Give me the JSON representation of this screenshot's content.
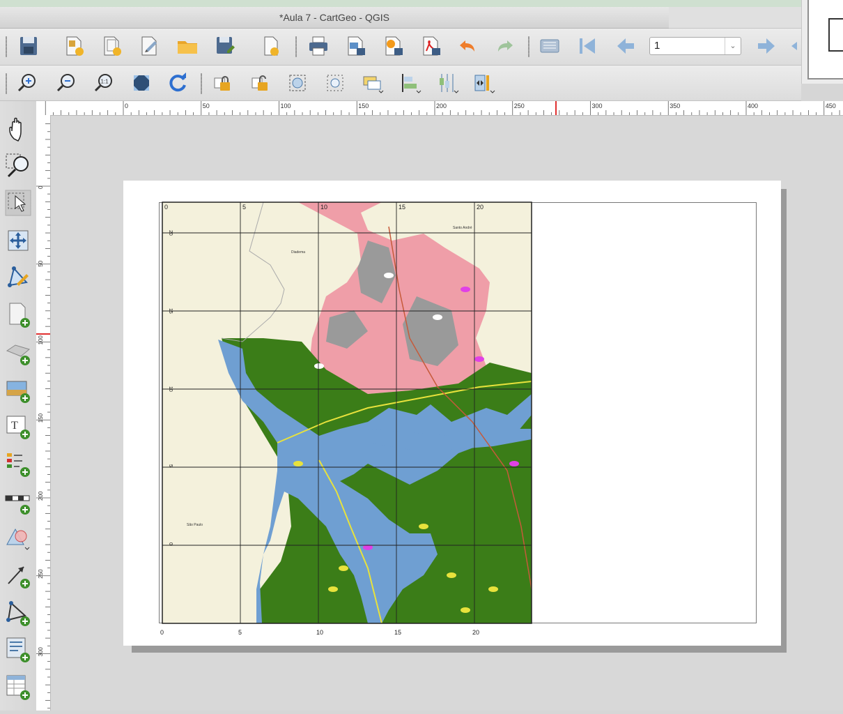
{
  "window": {
    "title": "*Aula 7 - CartGeo - QGIS"
  },
  "atlas": {
    "page_value": "1"
  },
  "rulers": {
    "horizontal": [
      "0",
      "50",
      "100",
      "150",
      "200",
      "250",
      "300",
      "350",
      "400",
      "450"
    ],
    "vertical": [
      "0",
      "50",
      "100",
      "150",
      "200",
      "250",
      "300"
    ]
  },
  "map": {
    "x_ticks": [
      "0",
      "5",
      "10",
      "15",
      "20"
    ],
    "y_ticks_left": [
      "20",
      "15",
      "10",
      "5",
      "0"
    ],
    "top_ticks": [
      "0",
      "5",
      "10",
      "15",
      "20"
    ],
    "places": {
      "diadema": "Diadema",
      "santo_andre": "Santo André",
      "sao_paulo": "São Paulo"
    }
  },
  "colors": {
    "water": "#6f9fd2",
    "forest": "#3b7d18",
    "urban": "#ef9ea8",
    "dense_urban": "#9a9a9a",
    "background_land": "#f4f1dc",
    "grid": "#222222",
    "agriculture": "#e8e23c",
    "accent_magenta": "#e040e6"
  },
  "icons": {
    "toolbar1": [
      "save-icon",
      "new-composer-icon",
      "duplicate-composer-icon",
      "composer-manager-icon",
      "open-template-icon",
      "save-template-icon",
      "new-page-icon",
      "print-icon",
      "export-image-icon",
      "export-svg-icon",
      "export-pdf-icon",
      "undo-icon",
      "redo-icon",
      "atlas-preview-icon",
      "first-feature-icon",
      "previous-feature-icon",
      "next-feature-icon"
    ],
    "toolbar2": [
      "zoom-in-icon",
      "zoom-out-icon",
      "zoom-100-icon",
      "zoom-full-icon",
      "refresh-icon",
      "lock-items-icon",
      "unlock-items-icon",
      "group-items-icon",
      "ungroup-items-icon",
      "raise-items-icon",
      "align-items-icon",
      "distribute-items-icon",
      "resize-items-icon"
    ],
    "left": [
      "pan-icon",
      "zoom-tool-icon",
      "select-move-icon",
      "move-item-content-icon",
      "edit-nodes-icon",
      "add-map-icon",
      "add-3d-map-icon",
      "add-picture-icon",
      "add-label-icon",
      "add-legend-icon",
      "add-scalebar-icon",
      "add-shape-icon",
      "add-arrow-icon",
      "add-node-item-icon",
      "add-html-icon",
      "add-attribute-table-icon"
    ]
  }
}
